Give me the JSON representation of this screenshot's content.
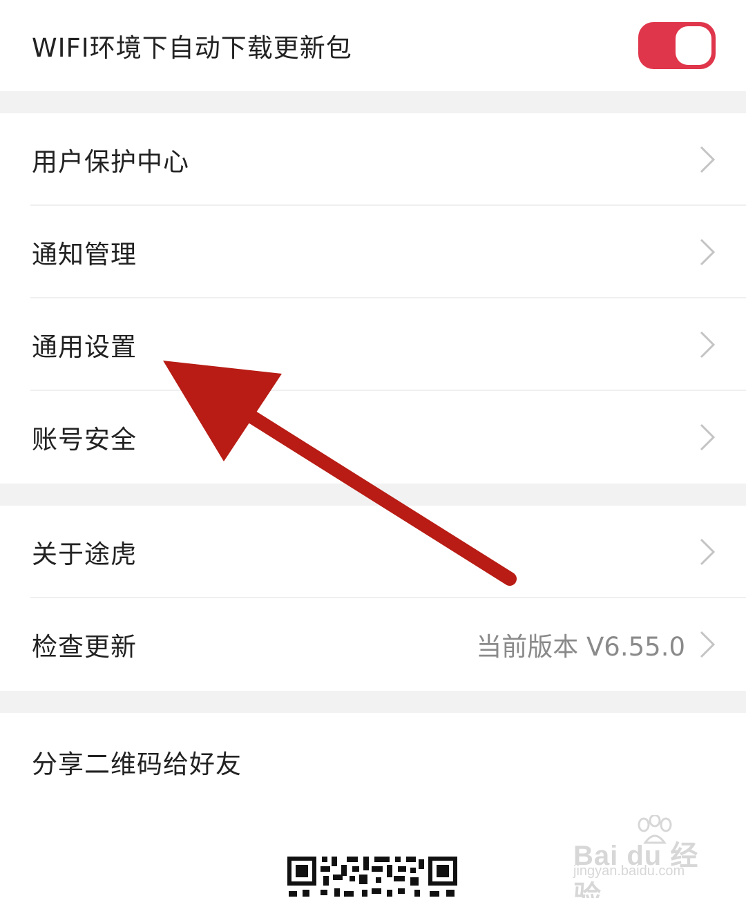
{
  "settings": {
    "wifi_auto_update": {
      "label": "WIFI环境下自动下载更新包",
      "enabled": true
    },
    "group1": [
      {
        "label": "用户保护中心"
      },
      {
        "label": "通知管理"
      },
      {
        "label": "通用设置"
      },
      {
        "label": "账号安全"
      }
    ],
    "group2": [
      {
        "label": "关于途虎"
      },
      {
        "label": "检查更新",
        "value": "当前版本 V6.55.0"
      }
    ],
    "share": {
      "title": "分享二维码给好友"
    }
  },
  "watermark": {
    "brand": "Bai du 经验",
    "domain": "jingyan.baidu.com"
  },
  "colors": {
    "toggle_on": "#e0364b",
    "section_gap": "#f2f2f2",
    "arrow": "#b81c14",
    "secondary_text": "#8a8a8a"
  },
  "icons": {
    "chevron": "chevron-right-icon",
    "annotation": "red-arrow-annotation"
  }
}
